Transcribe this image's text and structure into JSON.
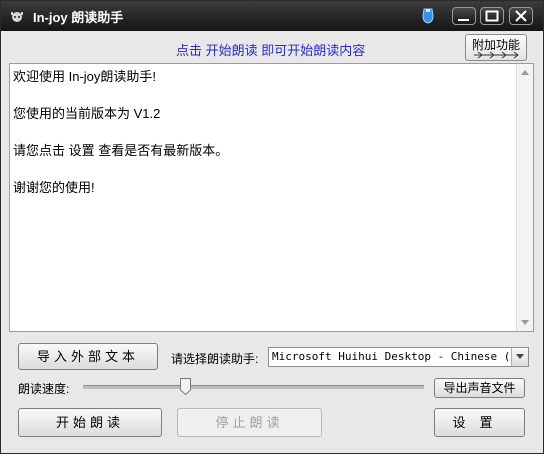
{
  "window": {
    "title": "In-joy 朗读助手"
  },
  "hint": {
    "text": "点击 开始朗读 即可开始朗读内容"
  },
  "extra_button": {
    "label": "附加功能",
    "arrows": "→→→→"
  },
  "content": {
    "text": "欢迎使用 In-joy朗读助手!\n\n您使用的当前版本为 V1.2\n\n请您点击 设置 查看是否有最新版本。\n\n谢谢您的使用!"
  },
  "controls": {
    "import_label": "导入外部文本",
    "voice_prompt": "请选择朗读助手:",
    "voice_selected": "Microsoft Huihui Desktop - Chinese (Simplified)",
    "speed_label": "朗读速度:",
    "speed_level": 0.3,
    "export_label": "导出声音文件",
    "start_label": "开始朗读",
    "stop_label": "停止朗读",
    "settings_label": "设置"
  },
  "colors": {
    "hint_text": "#2a2ad0",
    "titlebar": "#1e1e1e",
    "pin_icon": "#3b8fe6"
  }
}
